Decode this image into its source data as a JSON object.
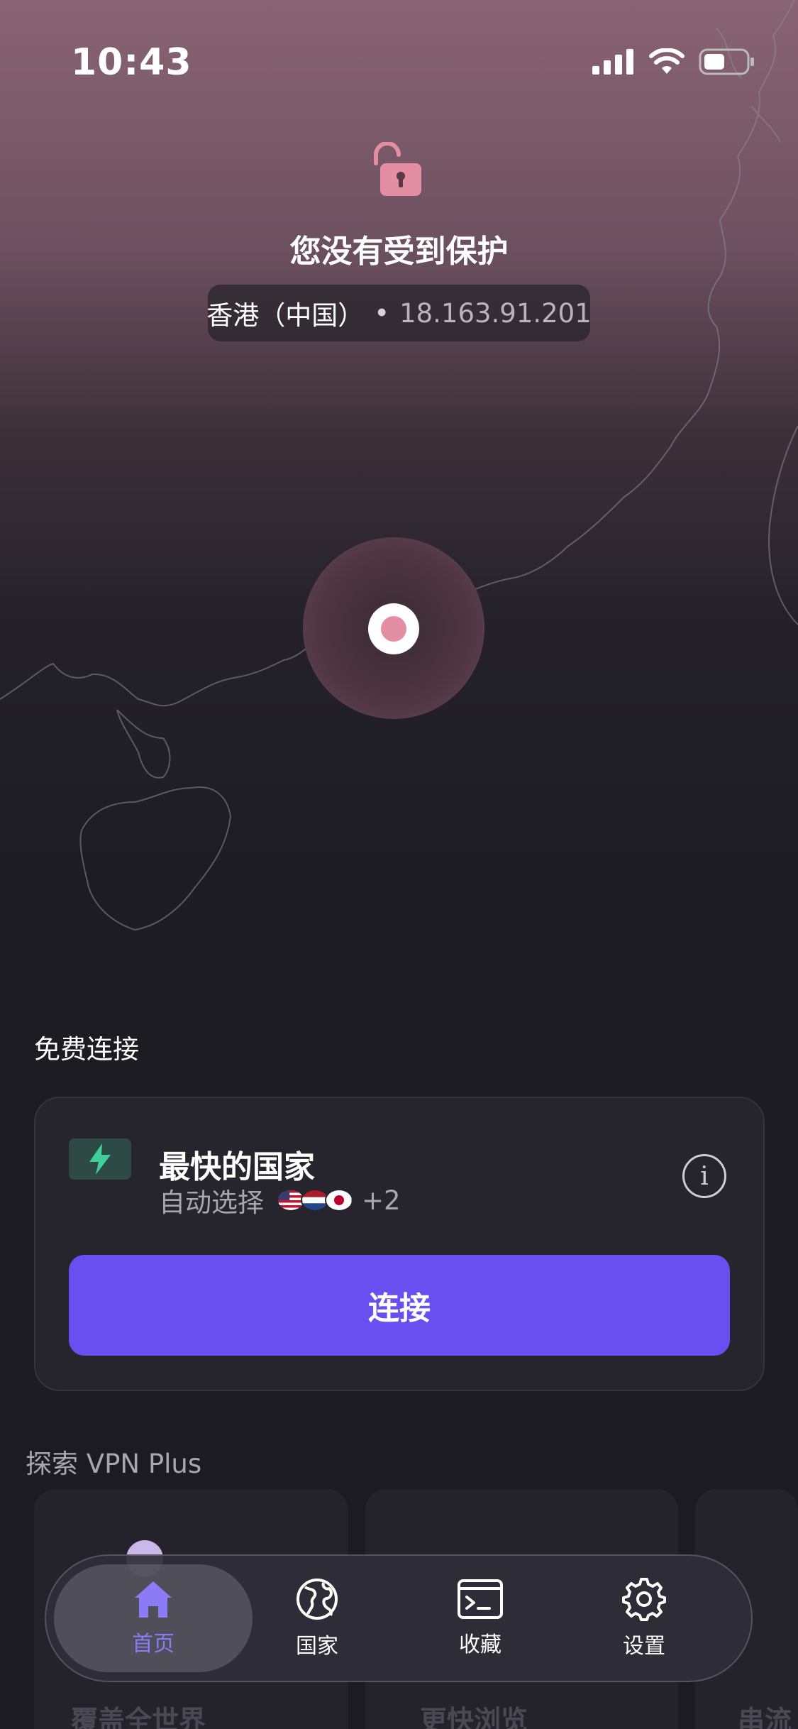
{
  "status_bar": {
    "time": "10:43"
  },
  "header": {
    "protection_status": "您没有受到保护",
    "location": "香港（中国）",
    "separator": "•",
    "ip": "18.163.91.201"
  },
  "free_connect": {
    "section_label": "免费连接",
    "fastest_title": "最快的国家",
    "auto_select": "自动选择",
    "extra_count": "+2",
    "connect_label": "连接"
  },
  "explore": {
    "section_label": "探索 VPN Plus",
    "cards": [
      {
        "title": "覆盖全世界"
      },
      {
        "title": "更快浏览"
      },
      {
        "title": "串流"
      }
    ]
  },
  "tabs": [
    {
      "label": "首页",
      "icon": "home-icon",
      "active": true
    },
    {
      "label": "国家",
      "icon": "globe-icon",
      "active": false
    },
    {
      "label": "收藏",
      "icon": "terminal-icon",
      "active": false
    },
    {
      "label": "设置",
      "icon": "gear-icon",
      "active": false
    }
  ],
  "colors": {
    "accent": "#6a4ff0",
    "active_tab": "#8b7bf5",
    "unprotected": "#e48ea3",
    "bolt": "#3ecf9a"
  }
}
